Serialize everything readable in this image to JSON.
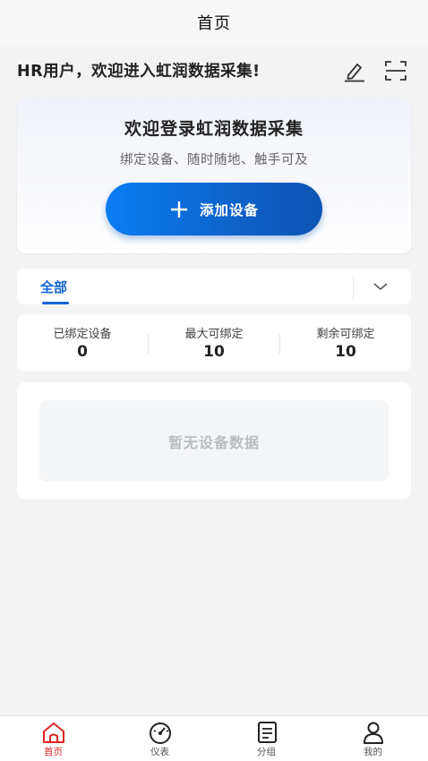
{
  "nav": {
    "title": "首页"
  },
  "greeting": {
    "text": "HR用户，欢迎进入虹润数据采集!",
    "edit_icon": "edit-pen-icon",
    "scan_icon": "scan-icon"
  },
  "welcome": {
    "title": "欢迎登录虹润数据采集",
    "subtitle": "绑定设备、随时随地、触手可及",
    "add_button_label": "添加设备",
    "add_icon": "plus-icon"
  },
  "tabs": {
    "active_label": "全部",
    "dropdown_icon": "chevron-down-icon"
  },
  "stats": [
    {
      "label": "已绑定设备",
      "value": "0"
    },
    {
      "label": "最大可绑定",
      "value": "10"
    },
    {
      "label": "剩余可绑定",
      "value": "10"
    }
  ],
  "device_list": {
    "empty_text": "暂无设备数据"
  },
  "bottom_nav": [
    {
      "label": "首页",
      "icon": "home-icon",
      "active": true
    },
    {
      "label": "仪表",
      "icon": "gauge-icon",
      "active": false
    },
    {
      "label": "分组",
      "icon": "group-list-icon",
      "active": false
    },
    {
      "label": "我的",
      "icon": "user-icon",
      "active": false
    }
  ],
  "colors": {
    "accent": "#1366d6",
    "button_gradient_start": "#0a7df2",
    "button_gradient_end": "#0d54b3",
    "active_tab": "#e02424"
  }
}
